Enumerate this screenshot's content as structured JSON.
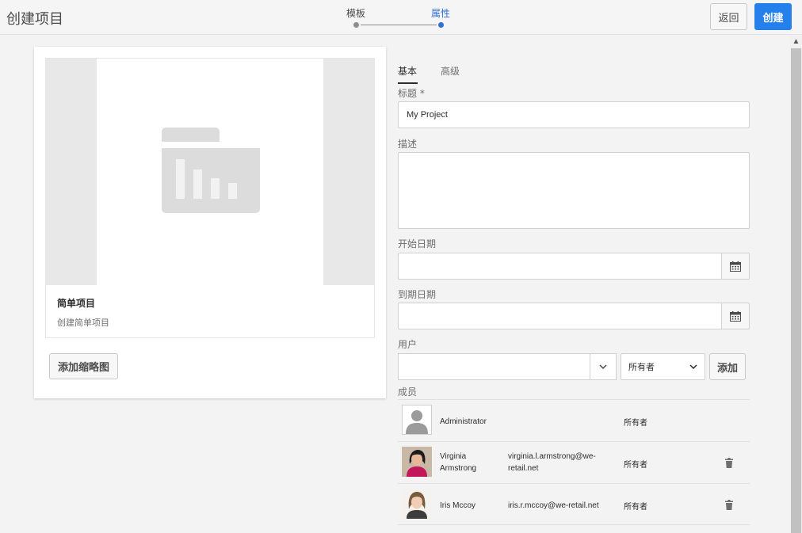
{
  "header": {
    "title": "创建项目",
    "steps": [
      {
        "label": "模板",
        "state": "done"
      },
      {
        "label": "属性",
        "state": "active"
      }
    ],
    "back_label": "返回",
    "create_label": "创建"
  },
  "template": {
    "title": "简单项目",
    "description": "创建简单项目",
    "add_thumbnail_label": "添加缩略图",
    "icon": "folder-chart-icon"
  },
  "tabs": [
    {
      "label": "基本",
      "active": true
    },
    {
      "label": "高级",
      "active": false
    }
  ],
  "form": {
    "title_label": "标题 *",
    "title_value": "My Project",
    "description_label": "描述",
    "description_value": "",
    "start_date_label": "开始日期",
    "start_date_value": "",
    "due_date_label": "到期日期",
    "due_date_value": "",
    "user_label": "用户",
    "user_value": "",
    "role_value": "所有者",
    "add_label": "添加",
    "members_label": "成员"
  },
  "members": [
    {
      "name": "Administrator",
      "email": "",
      "role": "所有者",
      "avatar": "default-user-avatar",
      "deletable": false
    },
    {
      "name": "Virginia Armstrong",
      "email": "virginia.l.armstrong@we-retail.net",
      "role": "所有者",
      "avatar": "photo-avatar",
      "deletable": true
    },
    {
      "name": "Iris Mccoy",
      "email": "iris.r.mccoy@we-retail.net",
      "role": "所有者",
      "avatar": "photo-avatar",
      "deletable": true
    }
  ],
  "colors": {
    "accent": "#2680eb",
    "step_active": "#2d6fd4"
  }
}
